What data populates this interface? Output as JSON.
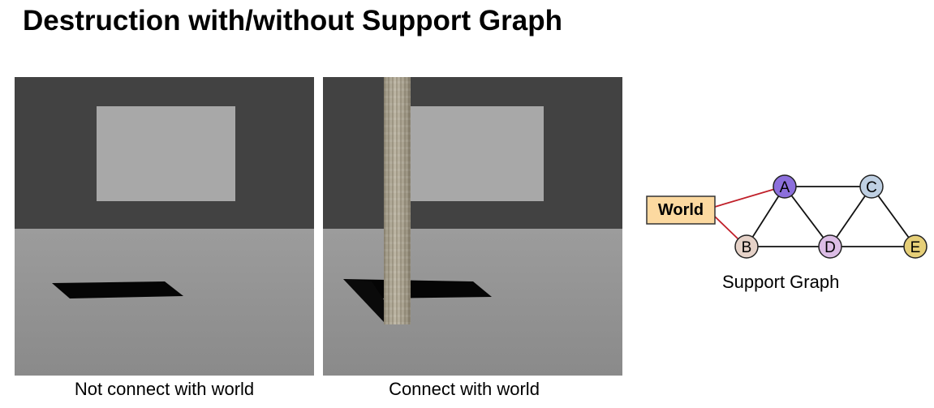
{
  "slide": {
    "title": "Destruction with/without Support Graph"
  },
  "panels": [
    {
      "caption": "Not connect with world"
    },
    {
      "caption": "Connect with world"
    }
  ],
  "graph": {
    "caption": "Support Graph",
    "world_label": "World",
    "nodes": [
      {
        "id": "A",
        "label": "A",
        "color": "#8c6fdc"
      },
      {
        "id": "B",
        "label": "B",
        "color": "#e6d2c8"
      },
      {
        "id": "C",
        "label": "C",
        "color": "#bfd0e3"
      },
      {
        "id": "D",
        "label": "D",
        "color": "#dcbde6"
      },
      {
        "id": "E",
        "label": "E",
        "color": "#e6cf78"
      }
    ],
    "world_color": "#fcd9a0",
    "world_link_color": "#c0202a"
  }
}
